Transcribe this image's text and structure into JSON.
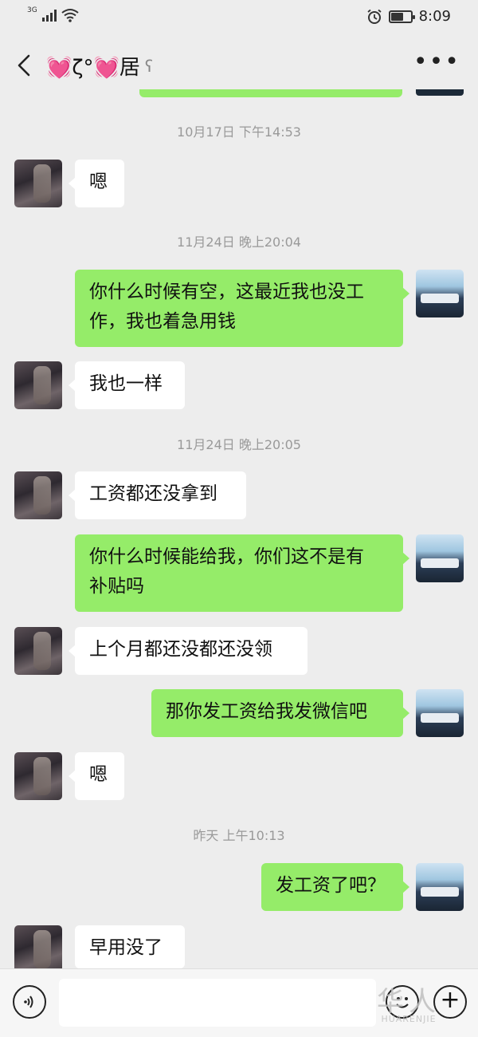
{
  "status_bar": {
    "network": "3G",
    "time": "8:09",
    "battery_level": 0.65,
    "icons": [
      "signal-icon",
      "wifi-icon",
      "alarm-icon",
      "battery-icon"
    ]
  },
  "header": {
    "title": "💓ζ°💓居",
    "icons": [
      "back-icon",
      "ear-icon",
      "more-icon"
    ]
  },
  "colors": {
    "background": "#ededed",
    "sent_bubble": "#95ec69",
    "received_bubble": "#ffffff",
    "timestamp_text": "#999999"
  },
  "messages": [
    {
      "type": "timestamp",
      "text": "10月17日 下午14:53"
    },
    {
      "type": "received",
      "text": "嗯"
    },
    {
      "type": "timestamp",
      "text": "11月24日 晚上20:04"
    },
    {
      "type": "sent",
      "lines": [
        "你什么时候有空，这最近我也没工",
        "作，我也着急用钱"
      ]
    },
    {
      "type": "received",
      "text": "我也一样"
    },
    {
      "type": "timestamp",
      "text": "11月24日 晚上20:05"
    },
    {
      "type": "received",
      "text": "工资都还没拿到"
    },
    {
      "type": "sent",
      "lines": [
        "你什么时候能给我，你们这不是有",
        "补贴吗"
      ]
    },
    {
      "type": "received",
      "text": "上个月都还没都还没领"
    },
    {
      "type": "sent",
      "text": "那你发工资给我发微信吧"
    },
    {
      "type": "received",
      "text": "嗯"
    },
    {
      "type": "timestamp",
      "text": "昨天 上午10:13"
    },
    {
      "type": "sent",
      "text": "发工资了吧？"
    },
    {
      "type": "received",
      "text": "早用没了"
    }
  ],
  "input_bar": {
    "icons": [
      "voice-icon",
      "emoji-icon",
      "plus-icon"
    ]
  },
  "watermark": {
    "main": "华人",
    "sub": "HUARENJIE"
  }
}
